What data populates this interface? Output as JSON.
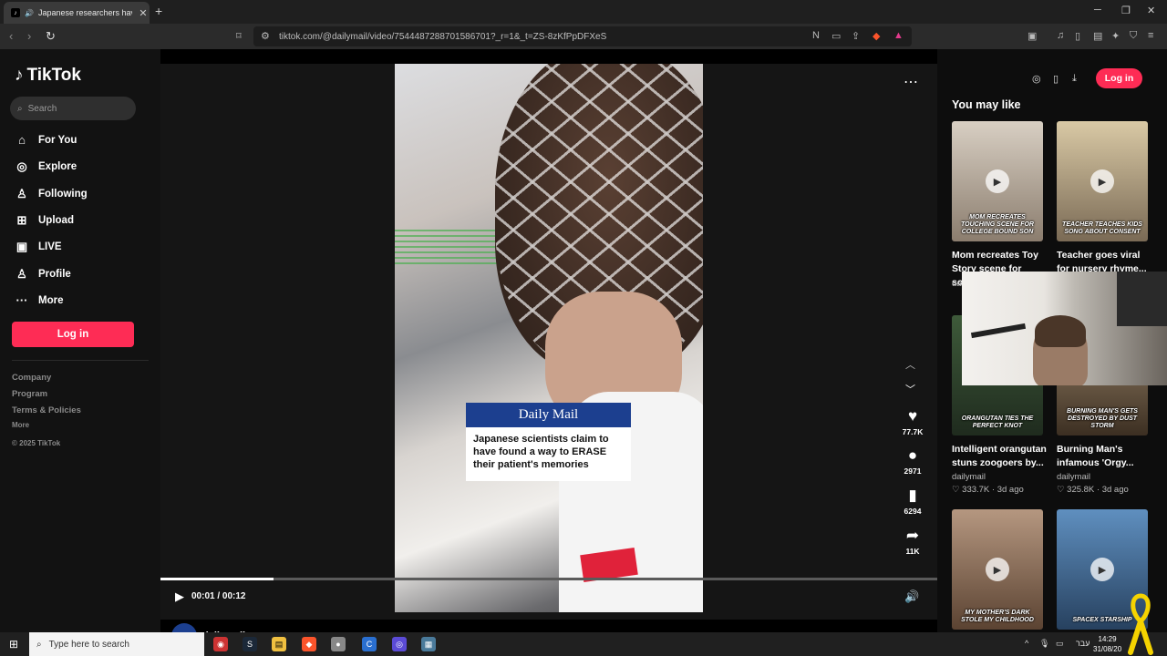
{
  "browser": {
    "tab_title": "Japanese researchers have cl",
    "url": "tiktok.com/@dailymail/video/7544487288701586701?_r=1&_t=ZS-8zKfPpDFXeS"
  },
  "tiktok": {
    "logo_text": "TikTok",
    "search_placeholder": "Search",
    "nav": [
      {
        "label": "For You"
      },
      {
        "label": "Explore"
      },
      {
        "label": "Following"
      },
      {
        "label": "Upload"
      },
      {
        "label": "LIVE"
      },
      {
        "label": "Profile"
      },
      {
        "label": "More"
      }
    ],
    "login_label": "Log in",
    "footer": {
      "company": "Company",
      "program": "Program",
      "terms": "Terms & Policies",
      "more": "More",
      "copyright": "© 2025 TikTok"
    }
  },
  "video": {
    "caption_brand": "Daily Mail",
    "caption_text": "Japanese scientists claim to have found a way to ERASE their patient's memories",
    "likes": "77.7K",
    "comments": "2971",
    "saves": "6294",
    "shares": "11K",
    "time": "00:01 / 00:12",
    "progress": 0.145,
    "author": "dailymail"
  },
  "right_rail": {
    "login_label": "Log in",
    "title": "You may like",
    "items": [
      {
        "overlay": "MOM RECREATES TOUCHING SCENE FOR COLLEGE BOUND SON",
        "title": "Mom recreates Toy Story scene for son...",
        "meta": "da"
      },
      {
        "overlay": "TEACHER TEACHES KIDS SONG ABOUT CONSENT",
        "title": "Teacher goes viral for nursery rhyme...",
        "meta": ""
      },
      {
        "overlay": "ORANGUTAN TIES THE PERFECT KNOT",
        "title": "Intelligent orangutan stuns zoogoers by...",
        "author": "dailymail",
        "stats": "♡ 333.7K · 3d ago"
      },
      {
        "overlay": "BURNING MAN'S GETS DESTROYED BY DUST STORM",
        "title": "Burning Man's infamous 'Orgy...",
        "author": "dailymail",
        "stats": "♡ 325.8K · 3d ago"
      },
      {
        "overlay": "MY MOTHER'S DARK STOLE MY CHILDHOOD",
        "title": "",
        "meta": ""
      },
      {
        "overlay": "SPACEX STARSHIP",
        "title": "",
        "meta": ""
      }
    ]
  },
  "taskbar": {
    "search_placeholder": "Type here to search",
    "lang": "עבר",
    "time": "14:29",
    "date": "31/08/20"
  },
  "colors": {
    "accent": "#fe2c55",
    "dailymail_blue": "#1c3f8f"
  }
}
